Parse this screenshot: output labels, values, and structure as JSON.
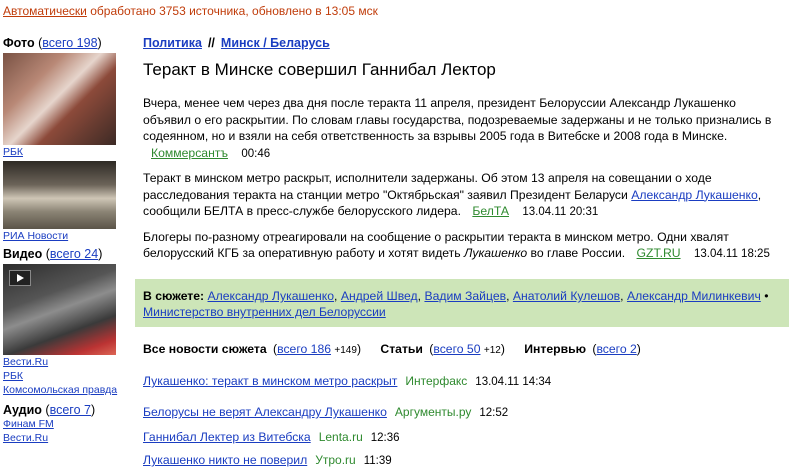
{
  "topline": {
    "auto_link": "Автоматически",
    "rest": " обработано 3753 источника, обновлено в 13:05 мск"
  },
  "left": {
    "photo": {
      "title": "Фото",
      "count_link": "всего 198",
      "sources": [
        "РБК",
        "РИА Новости"
      ]
    },
    "video": {
      "title": "Видео",
      "count_link": "всего 24",
      "sources": [
        "Вести.Ru",
        "РБК",
        "Комсомольская правда"
      ]
    },
    "audio": {
      "title": "Аудио",
      "count_link": "всего 7",
      "sources": [
        "Финам FM",
        "Вести.Ru"
      ]
    }
  },
  "breadcrumb": {
    "items": [
      "Политика",
      "Минск / Беларусь"
    ],
    "separator": "//"
  },
  "headline": "Теракт в Минске совершил Ганнибал Лектор",
  "news": [
    {
      "text": "Вчера, менее чем через два дня после теракта 11 апреля, президент Белоруссии Александр Лукашенко объявил о его раскрытии. По словам главы государства, подозреваемые задержаны и не только признались в содеянном, но и взяли на себя ответственность за взрывы 2005 года в Витебске и 2008 года в Минске.",
      "agency": "Коммерсантъ",
      "time": "00:46"
    },
    {
      "text_before": "Теракт в минском метро раскрыт, исполнители задержаны. Об этом 13 апреля на совещании о ходе расследования теракта на станции метро \"Октябрьская\" заявил Президент Беларуси ",
      "link": "Александр Лукашенко",
      "text_after": ", сообщили БЕЛТА в пресс-службе белорусского лидера.",
      "agency": "БелТА",
      "time": "13.04.11 20:31"
    },
    {
      "text_before": "Блогеры по-разному отреагировали на сообщение о раскрытии теракта в минском метро. Одни хвалят белорусский КГБ за оперативную работу и хотят видеть ",
      "italic": "Лукашенко",
      "text_after": " во главе России.",
      "agency": "GZT.RU",
      "time": "13.04.11 18:25"
    }
  ],
  "story": {
    "label": "В сюжете:",
    "links": [
      "Александр Лукашенко",
      "Андрей Швед",
      "Вадим Зайцев",
      "Анатолий Кулешов",
      "Александр Милинкевич",
      "Министерство внутренних дел Белоруссии"
    ]
  },
  "allnews": {
    "news_label": "Все новости сюжета",
    "news_link": "всего 186",
    "news_new": "+149",
    "articles_label": "Статьи",
    "articles_link": "всего 50",
    "articles_new": "+12",
    "interview_label": "Интервью",
    "interview_link": "всего 2"
  },
  "items": [
    {
      "title": "Лукашенко: теракт в минском метро раскрыт",
      "agency": "Интерфакс",
      "time": "13.04.11 14:34"
    },
    {
      "title": "Белорусы не верят Александру Лукашенко",
      "agency": "Аргументы.ру",
      "time": "12:52"
    },
    {
      "title": "Ганнибал Лектер из Витебска",
      "agency": "Lenta.ru",
      "time": "12:36"
    },
    {
      "title": "Лукашенко никто не поверил",
      "agency": "Утро.ru",
      "time": "11:39"
    }
  ],
  "colors": {
    "link": "#1a3dc1",
    "agency": "#2f8a2f",
    "topline": "#c03c0a",
    "story_bg": "#cde5b8"
  }
}
